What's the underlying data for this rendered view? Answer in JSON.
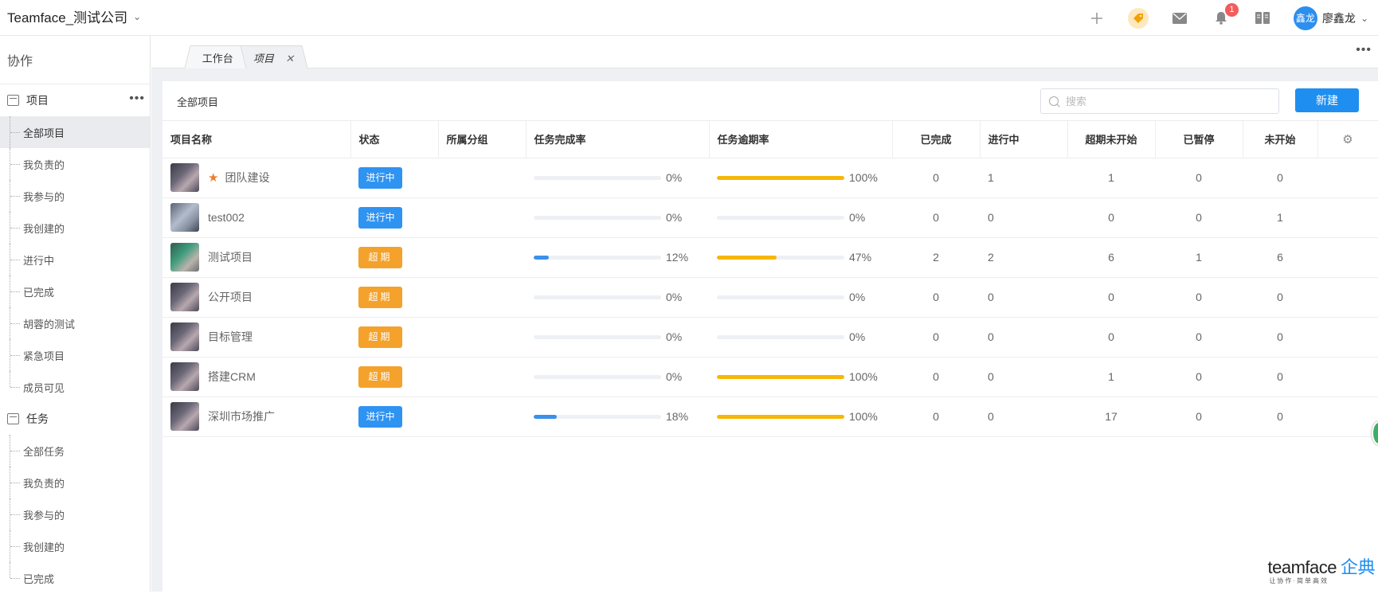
{
  "header": {
    "company": "Teamface_测试公司",
    "notification_count": "1",
    "user_avatar": "鑫龙",
    "user_name": "廖鑫龙"
  },
  "icons": {
    "add": "plus-icon",
    "tag": "tag-icon",
    "mail": "mail-icon",
    "bell": "bell-icon",
    "book": "book-icon",
    "settings": "gear-icon"
  },
  "sidebar": {
    "title": "协作",
    "project_group": "项目",
    "project_items": [
      "全部项目",
      "我负责的",
      "我参与的",
      "我创建的",
      "进行中",
      "已完成",
      "胡蓉的测试",
      "紧急项目",
      "成员可见"
    ],
    "task_group": "任务",
    "task_items": [
      "全部任务",
      "我负责的",
      "我参与的",
      "我创建的",
      "已完成"
    ]
  },
  "tabs": [
    {
      "label": "工作台"
    },
    {
      "label": "项目"
    }
  ],
  "panel": {
    "title": "全部项目",
    "search_placeholder": "搜索",
    "new_button": "新建"
  },
  "table": {
    "columns": [
      "项目名称",
      "状态",
      "所属分组",
      "任务完成率",
      "任务逾期率",
      "已完成",
      "进行中",
      "超期未开始",
      "已暂停",
      "未开始"
    ],
    "rows": [
      {
        "name": "团队建设",
        "starred": true,
        "thumb": "v1",
        "status": "进行中",
        "status_type": "blue",
        "group": "",
        "done_rate": 0,
        "done_rate_text": "0%",
        "late_rate": 100,
        "late_rate_text": "100%",
        "completed": "0",
        "in_progress": "1",
        "overdue_unstarted": "1",
        "paused": "0",
        "not_started": "0"
      },
      {
        "name": "test002",
        "starred": false,
        "thumb": "v2",
        "status": "进行中",
        "status_type": "blue",
        "group": "",
        "done_rate": 0,
        "done_rate_text": "0%",
        "late_rate": 0,
        "late_rate_text": "0%",
        "completed": "0",
        "in_progress": "0",
        "overdue_unstarted": "0",
        "paused": "0",
        "not_started": "1"
      },
      {
        "name": "测试项目",
        "starred": false,
        "thumb": "v3",
        "status": "超期",
        "status_type": "orange",
        "group": "",
        "done_rate": 12,
        "done_rate_text": "12%",
        "late_rate": 47,
        "late_rate_text": "47%",
        "completed": "2",
        "in_progress": "2",
        "overdue_unstarted": "6",
        "paused": "1",
        "not_started": "6"
      },
      {
        "name": "公开项目",
        "starred": false,
        "thumb": "v1",
        "status": "超期",
        "status_type": "orange",
        "group": "",
        "done_rate": 0,
        "done_rate_text": "0%",
        "late_rate": 0,
        "late_rate_text": "0%",
        "completed": "0",
        "in_progress": "0",
        "overdue_unstarted": "0",
        "paused": "0",
        "not_started": "0"
      },
      {
        "name": "目标管理",
        "starred": false,
        "thumb": "v1",
        "status": "超期",
        "status_type": "orange",
        "group": "",
        "done_rate": 0,
        "done_rate_text": "0%",
        "late_rate": 0,
        "late_rate_text": "0%",
        "completed": "0",
        "in_progress": "0",
        "overdue_unstarted": "0",
        "paused": "0",
        "not_started": "0"
      },
      {
        "name": "搭建CRM",
        "starred": false,
        "thumb": "v1",
        "status": "超期",
        "status_type": "orange",
        "group": "",
        "done_rate": 0,
        "done_rate_text": "0%",
        "late_rate": 100,
        "late_rate_text": "100%",
        "completed": "0",
        "in_progress": "0",
        "overdue_unstarted": "1",
        "paused": "0",
        "not_started": "0"
      },
      {
        "name": "深圳市场推广",
        "starred": false,
        "thumb": "v1",
        "status": "进行中",
        "status_type": "blue",
        "group": "",
        "done_rate": 18,
        "done_rate_text": "18%",
        "late_rate": 100,
        "late_rate_text": "100%",
        "completed": "0",
        "in_progress": "0",
        "overdue_unstarted": "17",
        "paused": "0",
        "not_started": "0"
      }
    ]
  },
  "brand": {
    "logo_text": "teamface",
    "logo_cn": "企典",
    "slogan": "让协作·简单高效"
  },
  "colors": {
    "accent": "#1e8ff0",
    "status_blue": "#2f93f2",
    "status_orange": "#f4a22b",
    "done_bar": "#3b90ea",
    "late_bar": "#f6b708"
  }
}
